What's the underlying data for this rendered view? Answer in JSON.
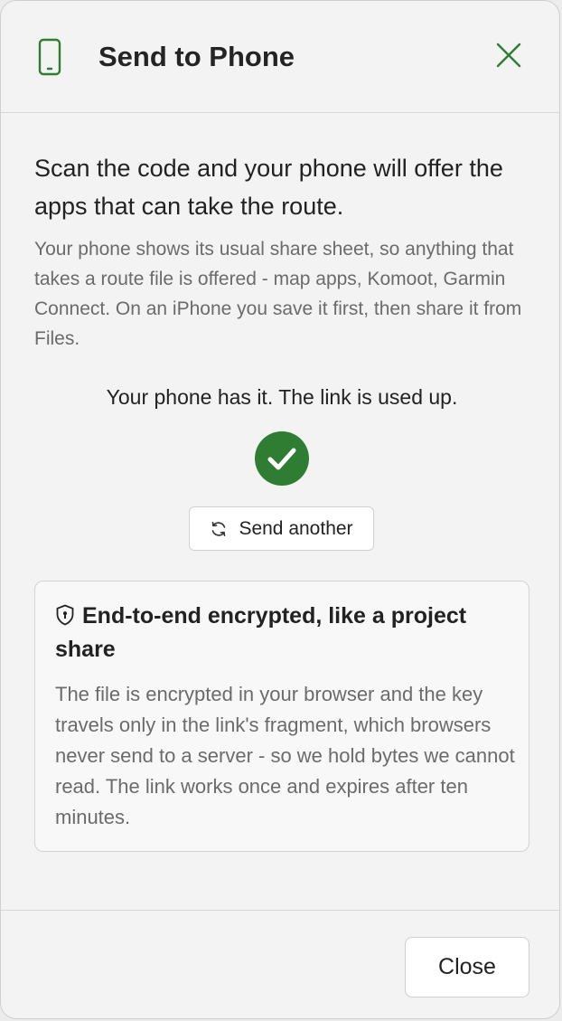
{
  "dialog": {
    "title": "Send to Phone",
    "header_icon": "phone-icon",
    "close_icon": "close-icon"
  },
  "content": {
    "lead": "Scan the code and your phone will offer the apps that can take the route.",
    "description": "Your phone shows its usual share sheet, so anything that takes a route file is offered - map apps, Komoot, Garmin Connect. On an iPhone you save it first, then share it from Files.",
    "status_message": "Your phone has it. The link is used up.",
    "success_icon": "check-circle-icon",
    "send_another_label": "Send another",
    "send_another_icon": "refresh-icon"
  },
  "info_box": {
    "icon": "shield-lock-icon",
    "title": "End-to-end encrypted, like a project share",
    "text": "The file is encrypted in your browser and the key travels only in the link's fragment, which browsers never send to a server - so we hold bytes we cannot read. The link works once and expires after ten minutes."
  },
  "footer": {
    "close_label": "Close"
  },
  "colors": {
    "accent_green": "#2e7d32",
    "background": "#f3f3f3"
  }
}
